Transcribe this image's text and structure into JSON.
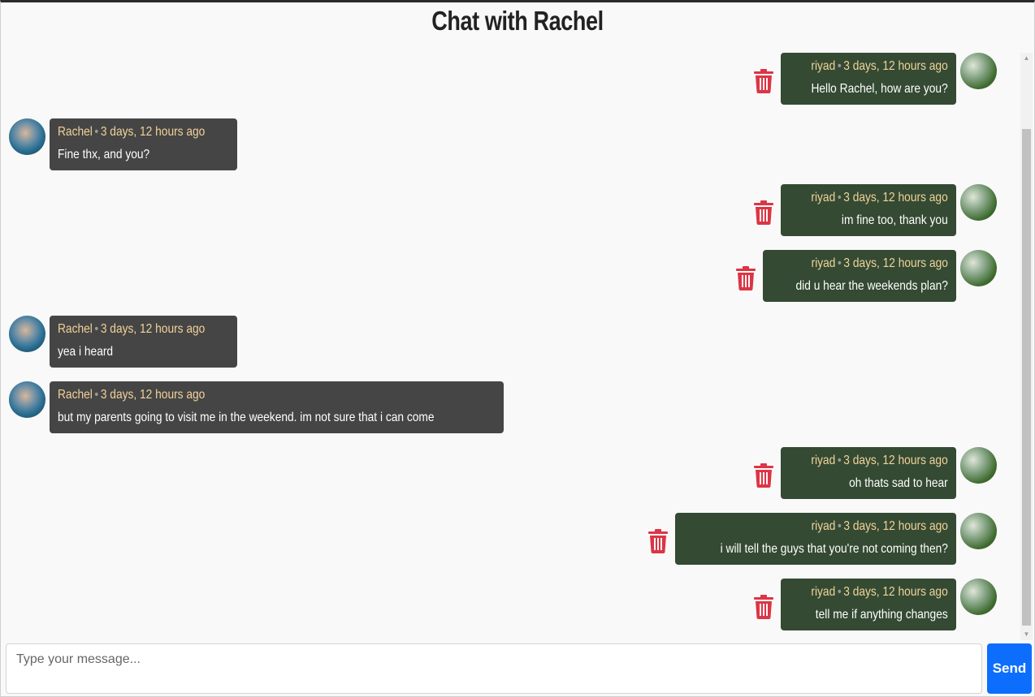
{
  "header": {
    "title": "Chat with Rachel"
  },
  "theme": {
    "my_bubble_color": "#344a33",
    "their_bubble_color": "#454545",
    "meta_color": "#f2d39a",
    "trash_color": "#dc3545",
    "send_color": "#0d6efd"
  },
  "messages": [
    {
      "sender": "riyad",
      "time": "3 days, 12 hours ago",
      "text": "Hello Rachel, how are you?",
      "mine": true
    },
    {
      "sender": "Rachel",
      "time": "3 days, 12 hours ago",
      "text": "Fine thx, and you?",
      "mine": false
    },
    {
      "sender": "riyad",
      "time": "3 days, 12 hours ago",
      "text": "im fine too, thank you",
      "mine": true
    },
    {
      "sender": "riyad",
      "time": "3 days, 12 hours ago",
      "text": "did u hear the weekends plan?",
      "mine": true
    },
    {
      "sender": "Rachel",
      "time": "3 days, 12 hours ago",
      "text": "yea i heard",
      "mine": false
    },
    {
      "sender": "Rachel",
      "time": "3 days, 12 hours ago",
      "text": "but my parents going to visit me in the weekend. im not sure that i can come",
      "mine": false
    },
    {
      "sender": "riyad",
      "time": "3 days, 12 hours ago",
      "text": "oh thats sad to hear",
      "mine": true
    },
    {
      "sender": "riyad",
      "time": "3 days, 12 hours ago",
      "text": "i will tell the guys that you're not coming then?",
      "mine": true
    },
    {
      "sender": "riyad",
      "time": "3 days, 12 hours ago",
      "text": "tell me if anything changes",
      "mine": true
    }
  ],
  "composer": {
    "placeholder": "Type your message...",
    "value": ""
  },
  "send": {
    "label": "Send"
  }
}
